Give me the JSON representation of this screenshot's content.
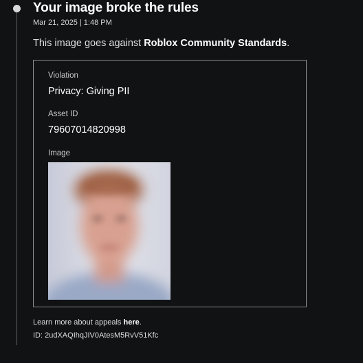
{
  "notice": {
    "title": "Your image broke the rules",
    "timestamp": "Mar 21, 2025 | 1:48 PM",
    "summary_prefix": "This image goes against ",
    "summary_link": "Roblox Community Standards",
    "summary_suffix": "."
  },
  "details": {
    "violation_label": "Violation",
    "violation_value": "Privacy: Giving PII",
    "asset_label": "Asset ID",
    "asset_value": "79607014820998",
    "image_label": "Image",
    "image_icon": "blurred-face-photo"
  },
  "footer": {
    "appeals_prefix": "Learn more about appeals ",
    "appeals_link": "here",
    "appeals_suffix": ".",
    "id_text": "ID: 2udXAQIhqJIV0AtesM5RvV51Kfc"
  },
  "colors": {
    "background": "#111214",
    "text": "#ffffff",
    "muted_text": "#dedede",
    "card_border": "#8b8d91",
    "timeline": "#5c5e63"
  }
}
